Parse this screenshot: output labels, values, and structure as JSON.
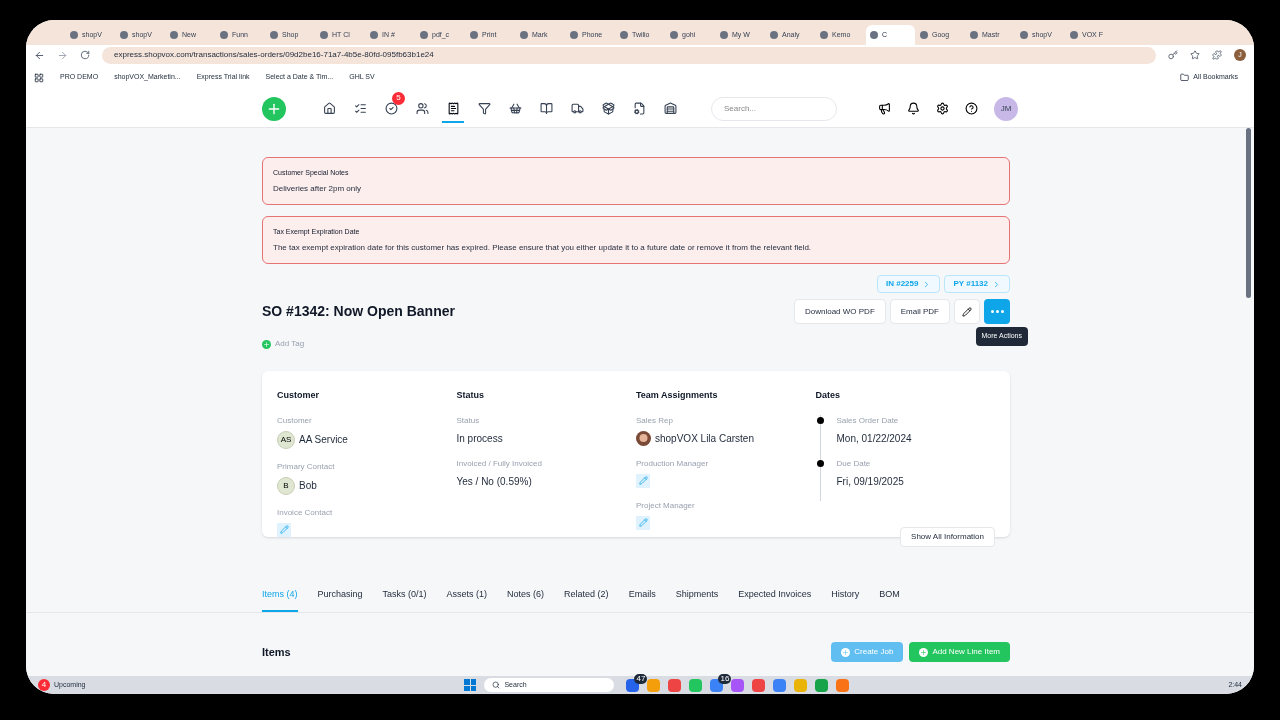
{
  "browser": {
    "tabs": [
      {
        "label": "shopV",
        "selected": false
      },
      {
        "label": "shopV",
        "selected": false
      },
      {
        "label": "New",
        "selected": false
      },
      {
        "label": "Funn",
        "selected": false
      },
      {
        "label": "Shop",
        "selected": false
      },
      {
        "label": "HT Cl",
        "selected": false
      },
      {
        "label": "IN #",
        "selected": false
      },
      {
        "label": "pdf_c",
        "selected": false
      },
      {
        "label": "Print",
        "selected": false
      },
      {
        "label": "Mark",
        "selected": false
      },
      {
        "label": "Phone",
        "selected": false
      },
      {
        "label": "Twilio",
        "selected": false
      },
      {
        "label": "gohi",
        "selected": false
      },
      {
        "label": "My W",
        "selected": false
      },
      {
        "label": "Analy",
        "selected": false
      },
      {
        "label": "Kemo",
        "selected": false
      },
      {
        "label": "C",
        "selected": true
      },
      {
        "label": "Goog",
        "selected": false
      },
      {
        "label": "Mastr",
        "selected": false
      },
      {
        "label": "shopV",
        "selected": false
      },
      {
        "label": "VOX F",
        "selected": false
      }
    ],
    "url": "express.shopvox.com/transactions/sales-orders/09d2be16-71a7-4b5e-80fd-095fb63b1e24",
    "bookmarks": [
      "PRO DEMO",
      "shopVOX_Marketin...",
      "Express Trial link",
      "Select a Date & Tim...",
      "GHL SV"
    ],
    "all_bookmarks": "All Bookmarks",
    "profile": "J"
  },
  "header": {
    "nav": [
      {
        "selected": false
      },
      {
        "selected": false
      },
      {
        "selected": false,
        "badge": "5"
      },
      {
        "selected": false
      },
      {
        "selected": true
      },
      {
        "selected": false
      },
      {
        "selected": false
      },
      {
        "selected": false
      },
      {
        "selected": false
      },
      {
        "selected": false
      },
      {
        "selected": false
      },
      {
        "selected": false
      }
    ],
    "search": {
      "placeholder": "Search..."
    },
    "avatar": "JM"
  },
  "notices": [
    {
      "title": "Customer Special Notes",
      "text": "Deliveries after 2pm only"
    },
    {
      "title": "Tax Exempt Expiration Date",
      "text": "The tax exempt expiration date for this customer has expired. Please ensure that you either update it to a future date or remove it from the relevant field."
    }
  ],
  "links": [
    "IN #2259",
    "PY #1132"
  ],
  "title": "SO #1342: Now Open Banner",
  "buttons": [
    "Download WO PDF",
    "Email PDF"
  ],
  "tooltip": "More Actions",
  "add_tag": "Add Tag",
  "columns": [
    {
      "heading": "Customer",
      "fields": [
        {
          "kind": "avatar",
          "label": "Customer",
          "initials": "AS",
          "value": "AA Service"
        },
        {
          "kind": "avatar",
          "label": "Primary Contact",
          "initials": "B",
          "value": "Bob"
        },
        {
          "kind": "edit",
          "label": "Invoice Contact"
        }
      ]
    },
    {
      "heading": "Status",
      "fields": [
        {
          "kind": "text",
          "label": "Status",
          "value": "In process"
        },
        {
          "kind": "text",
          "label": "Invoiced / Fully Invoiced",
          "value": "Yes / No (0.59%)"
        }
      ]
    },
    {
      "heading": "Team Assignments",
      "fields": [
        {
          "kind": "photo",
          "label": "Sales Rep",
          "value": "shopVOX Lila Carsten"
        },
        {
          "kind": "edit",
          "label": "Production Manager"
        },
        {
          "kind": "edit",
          "label": "Project Manager"
        }
      ]
    },
    {
      "heading": "Dates",
      "fields": [
        {
          "kind": "timeline",
          "label": "Sales Order Date",
          "value": "Mon, 01/22/2024"
        },
        {
          "kind": "timeline",
          "label": "Due Date",
          "value": "Fri, 09/19/2025"
        }
      ]
    }
  ],
  "show_all": "Show All Information",
  "tabs": [
    {
      "label": "Items (4)",
      "selected": true
    },
    {
      "label": "Purchasing",
      "selected": false
    },
    {
      "label": "Tasks (0/1)",
      "selected": false
    },
    {
      "label": "Assets (1)",
      "selected": false
    },
    {
      "label": "Notes (6)",
      "selected": false
    },
    {
      "label": "Related (2)",
      "selected": false
    },
    {
      "label": "Emails",
      "selected": false
    },
    {
      "label": "Shipments",
      "selected": false
    },
    {
      "label": "Expected Invoices",
      "selected": false
    },
    {
      "label": "History",
      "selected": false
    },
    {
      "label": "BOM",
      "selected": false
    }
  ],
  "items": {
    "heading": "Items",
    "buttons": [
      {
        "kind": "secondary",
        "label": "Create Job"
      },
      {
        "kind": "primary",
        "label": "Add New Line Item"
      }
    ]
  },
  "taskbar": {
    "badge": "4",
    "weather": "Upcoming",
    "search": "Search",
    "apps": [
      {
        "kind": "app",
        "badge": "47"
      },
      {
        "kind": "app"
      },
      {
        "kind": "app"
      },
      {
        "kind": "app"
      },
      {
        "kind": "app",
        "badge": "16"
      },
      {
        "kind": "app"
      },
      {
        "kind": "app"
      },
      {
        "kind": "app"
      },
      {
        "kind": "app"
      },
      {
        "kind": "app"
      },
      {
        "kind": "app"
      }
    ],
    "time": "2:44"
  }
}
